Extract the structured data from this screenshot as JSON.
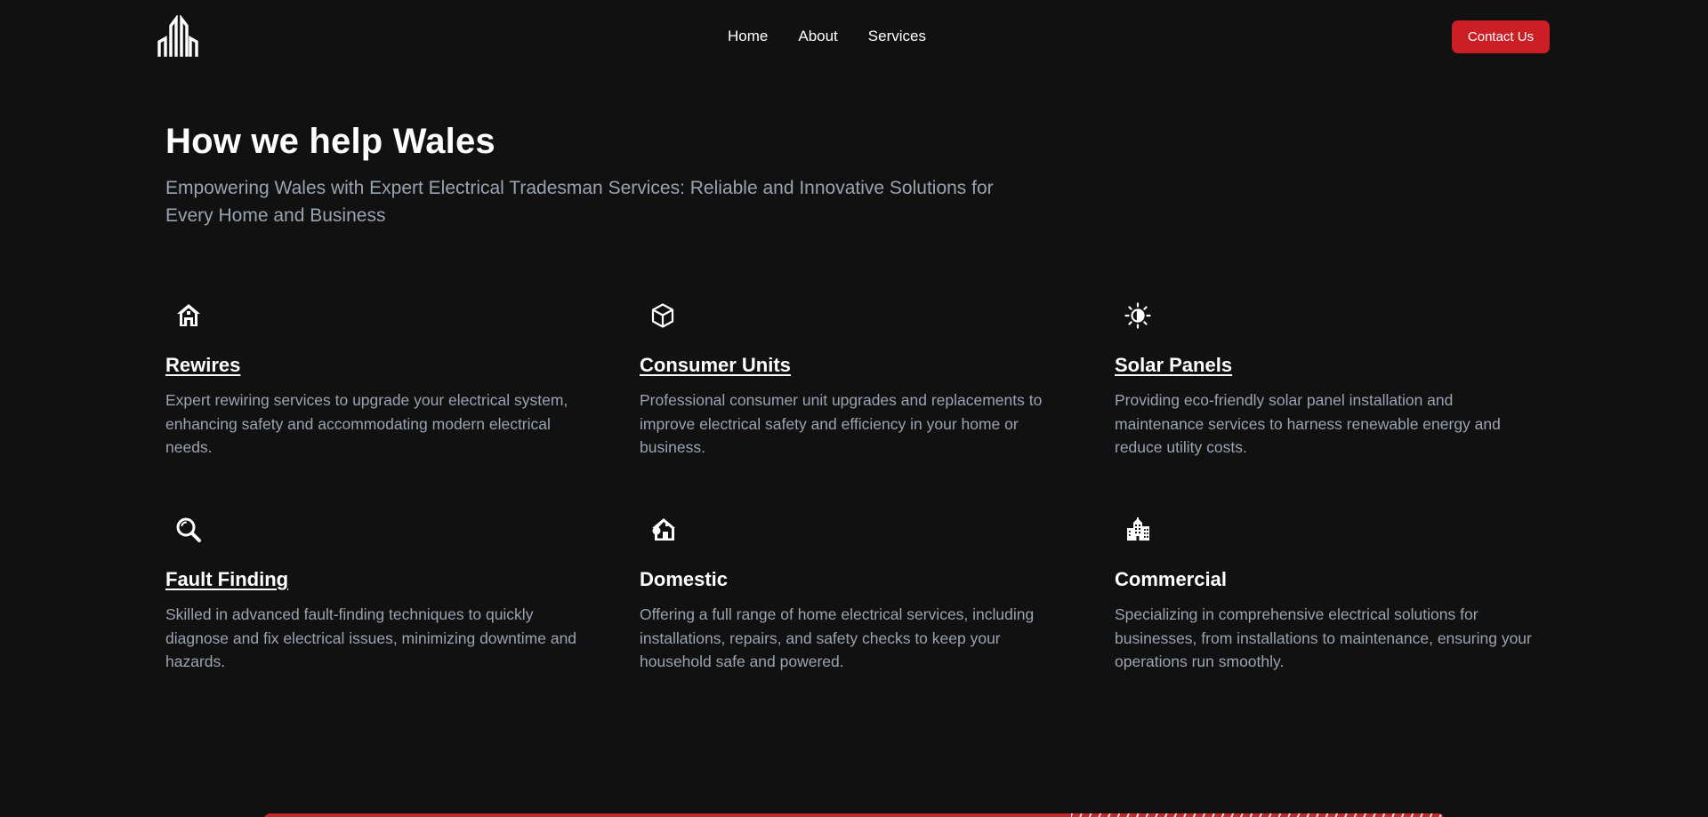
{
  "nav": {
    "items": [
      "Home",
      "About",
      "Services"
    ],
    "contact_label": "Contact Us"
  },
  "logo": {
    "icon": "building-logo-icon"
  },
  "intro": {
    "title": "How we help Wales",
    "subtitle": "Empowering Wales with Expert Electrical Tradesman Services: Reliable and Innovative Solutions for Every Home and Business"
  },
  "services": [
    {
      "icon": "house-icon",
      "title": "Rewires",
      "linked": true,
      "description": "Expert rewiring services to upgrade your electrical system, enhancing safety and accommodating modern electrical needs."
    },
    {
      "icon": "cube-icon",
      "title": "Consumer Units",
      "linked": true,
      "description": "Professional consumer unit upgrades and replacements to improve electrical safety and efficiency in your home or business."
    },
    {
      "icon": "sun-icon",
      "title": "Solar Panels",
      "linked": true,
      "description": "Providing eco-friendly solar panel installation and maintenance services to harness renewable energy and reduce utility costs."
    },
    {
      "icon": "magnifier-icon",
      "title": "Fault Finding",
      "linked": true,
      "description": "Skilled in advanced fault-finding techniques to quickly diagnose and fix electrical issues, minimizing downtime and hazards."
    },
    {
      "icon": "home-tree-icon",
      "title": "Domestic",
      "linked": false,
      "description": "Offering a full range of home electrical services, including installations, repairs, and safety checks to keep your household safe and powered."
    },
    {
      "icon": "buildings-icon",
      "title": "Commercial",
      "linked": false,
      "description": "Specializing in comprehensive electrical solutions for businesses, from installations to maintenance, ensuring your operations run smoothly."
    }
  ],
  "colors": {
    "background": "#111112",
    "accent": "#cc1f25",
    "muted_text": "#9aa3b0"
  }
}
